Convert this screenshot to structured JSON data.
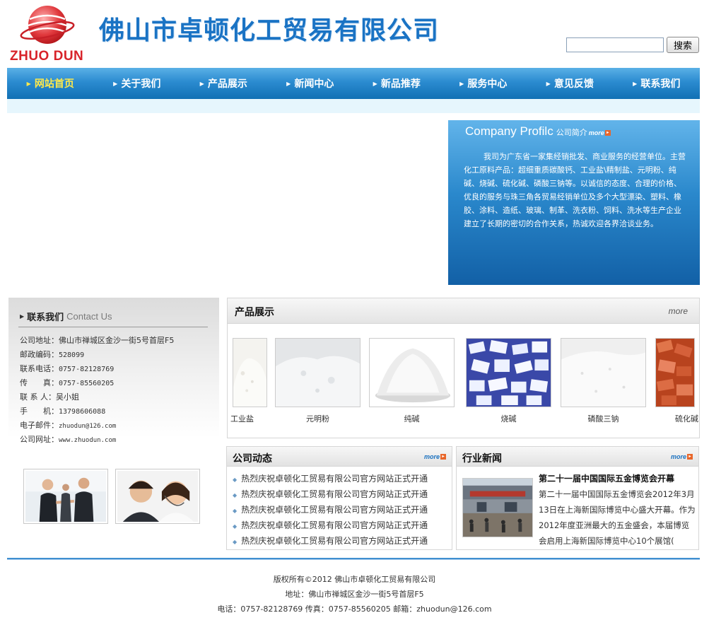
{
  "header": {
    "logo_text": "ZHUO DUN",
    "company_name": "佛山市卓顿化工贸易有限公司",
    "search": {
      "placeholder": "",
      "button_label": "搜索"
    }
  },
  "nav": {
    "items": [
      {
        "label": "网站首页",
        "active": true
      },
      {
        "label": "关于我们"
      },
      {
        "label": "产品展示"
      },
      {
        "label": "新闻中心"
      },
      {
        "label": "新品推荐"
      },
      {
        "label": "服务中心"
      },
      {
        "label": "意见反馈"
      },
      {
        "label": "联系我们"
      }
    ]
  },
  "profile": {
    "title_en": "Company Profilc",
    "title_cn": "公司简介",
    "more_label": "more",
    "text": "我司为广东省一家集经销批发、商业服务的经营单位。主营化工原料产品：超细重质碳酸钙、工业盐\\精制盐、元明粉、纯碱、烧碱、硫化碱、磷酸三钠等。以诚信的态度、合理的价格、优良的服务与珠三角各贸易经销单位及多个大型漂染、塑料、橡胶、涂料、造纸、玻璃、制革、洗衣粉、饲料、洗水等生产企业建立了长期的密切的合作关系，热诚欢迎各界洽谈业务。"
  },
  "contact": {
    "title_cn": "联系我们",
    "title_en": "Contact Us",
    "rows": [
      {
        "label": "公司地址：",
        "value": "佛山市禅城区金沙一街5号首层F5"
      },
      {
        "label": "邮政编码：",
        "value": "528099"
      },
      {
        "label": "联系电话：",
        "value": "0757-82128769"
      },
      {
        "label": "传　　真：",
        "value": "0757-85560205"
      },
      {
        "label": "联 系 人：",
        "value": "吴小姐"
      },
      {
        "label": "手　　机：",
        "value": "13798606088"
      },
      {
        "label": "电子邮件：",
        "value": "zhuodun@126.com"
      },
      {
        "label": "公司网址：",
        "value": "www.zhuodun.com"
      }
    ]
  },
  "products": {
    "title": "产品展示",
    "more_label": "more",
    "items": [
      {
        "name": "工业盐"
      },
      {
        "name": "元明粉"
      },
      {
        "name": "纯碱"
      },
      {
        "name": "烧碱"
      },
      {
        "name": "磷酸三钠"
      },
      {
        "name": "硫化碱"
      }
    ]
  },
  "company_news": {
    "title": "公司动态",
    "more_label": "more",
    "items": [
      "热烈庆祝卓顿化工贸易有限公司官方网站正式开通",
      "热烈庆祝卓顿化工贸易有限公司官方网站正式开通",
      "热烈庆祝卓顿化工贸易有限公司官方网站正式开通",
      "热烈庆祝卓顿化工贸易有限公司官方网站正式开通",
      "热烈庆祝卓顿化工贸易有限公司官方网站正式开通"
    ]
  },
  "industry_news": {
    "title": "行业新闻",
    "more_label": "more",
    "headline": "第二十一届中国国际五金博览会开幕",
    "text": "第二十一届中国国际五金博览会2012年3月13日在上海新国际博览中心盛大开幕。作为2012年度亚洲最大的五金盛会，本届博览会启用上海新国际博览中心10个展馆("
  },
  "footer": {
    "copyright": "版权所有©2012 佛山市卓顿化工贸易有限公司",
    "address": "地址：佛山市禅城区金沙一街5号首层F5",
    "contact_line": "电话：0757-82128769 传真：0757-85560205 邮箱：zhuodun@126.com"
  },
  "colors": {
    "brand_blue": "#1a73c4",
    "logo_red": "#d8232a",
    "nav_active": "#ffe94a",
    "footer_line": "#3f8fd0"
  }
}
